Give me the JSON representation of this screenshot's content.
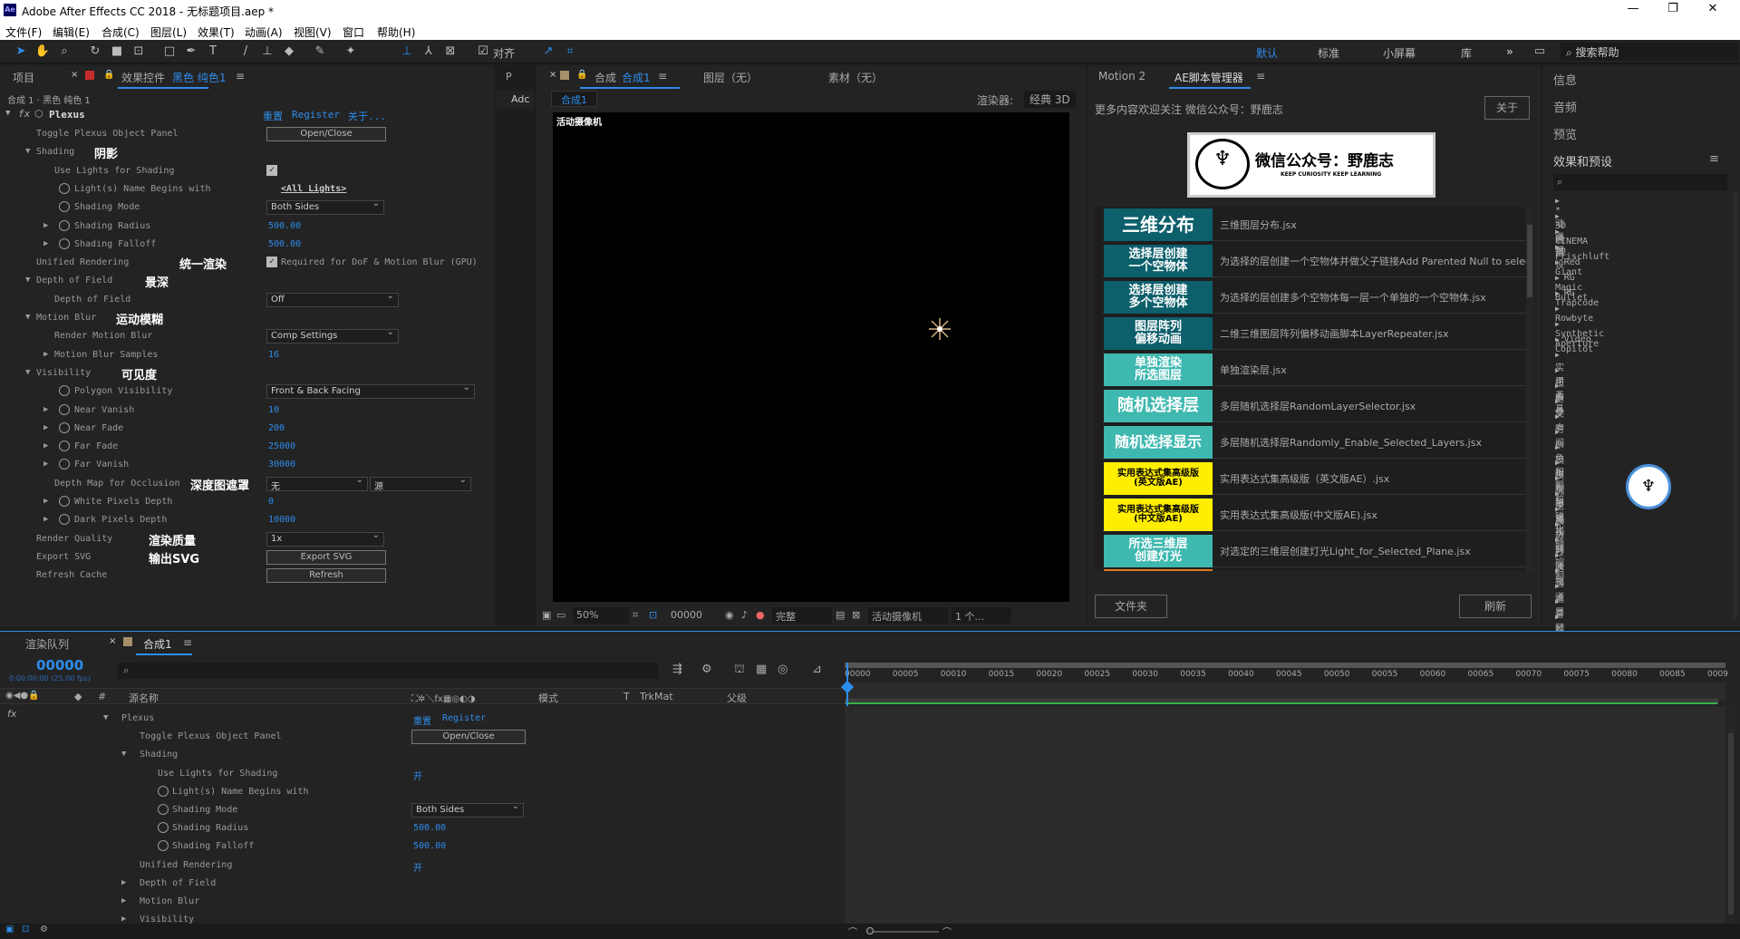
{
  "window": {
    "title": "Adobe After Effects CC 2018 - 无标题项目.aep *",
    "icon": "Ae",
    "min": "—",
    "max": "❐",
    "close": "✕"
  },
  "menu": [
    "文件(F)",
    "编辑(E)",
    "合成(C)",
    "图层(L)",
    "效果(T)",
    "动画(A)",
    "视图(V)",
    "窗口",
    "帮助(H)"
  ],
  "toolbar": {
    "align_label": "对齐",
    "workspaces": [
      "默认",
      "标准",
      "小屏幕",
      "库"
    ],
    "more": "»",
    "search_placeholder": "搜索帮助"
  },
  "project_panel": {
    "tab_project": "项目",
    "tab_effects_prefix": "效果控件",
    "tab_effects_layer": "黑色 纯色1",
    "menu": "≡",
    "breadcrumb": "合成 1 · 黑色 纯色 1",
    "effect_name": "Plexus",
    "reset": "重置",
    "register": "Register",
    "about": "关于..."
  },
  "effect_rows": [
    {
      "label": "Toggle Plexus Object Panel",
      "indent": 1,
      "button": "Open/Close"
    },
    {
      "label": "Shading",
      "indent": 1,
      "tri": "▼",
      "cn": "阴影"
    },
    {
      "label": "Use Lights for Shading",
      "indent": 3,
      "checkbox": true
    },
    {
      "label": "Light(s) Name Begins with",
      "indent": 3,
      "sw": true,
      "link": "<All Lights>"
    },
    {
      "label": "Shading Mode",
      "indent": 3,
      "sw": true,
      "dropdown": "Both Sides"
    },
    {
      "label": "Shading Radius",
      "indent": 3,
      "sw": true,
      "tri": "▶",
      "value": "500.00"
    },
    {
      "label": "Shading Falloff",
      "indent": 3,
      "sw": true,
      "tri": "▶",
      "value": "500.00"
    },
    {
      "label": "Unified Rendering",
      "indent": 1,
      "cn": "统一渲染",
      "checkbox": true,
      "checklabel": "Required for DoF & Motion Blur (GPU)"
    },
    {
      "label": "Depth of Field",
      "indent": 1,
      "tri": "▼",
      "cn": "景深"
    },
    {
      "label": "Depth of Field",
      "indent": 3,
      "dropdown": "Off"
    },
    {
      "label": "Motion Blur",
      "indent": 1,
      "tri": "▼",
      "cn": "运动模糊"
    },
    {
      "label": "Render Motion Blur",
      "indent": 3,
      "dropdown": "Comp Settings"
    },
    {
      "label": "Motion Blur Samples",
      "indent": 3,
      "tri": "▶",
      "value": "16"
    },
    {
      "label": "Visibility",
      "indent": 1,
      "tri": "▼",
      "cn": "可见度"
    },
    {
      "label": "Polygon Visibility",
      "indent": 3,
      "sw": true,
      "dropdown": "Front & Back Facing"
    },
    {
      "label": "Near Vanish",
      "indent": 3,
      "sw": true,
      "tri": "▶",
      "value": "10"
    },
    {
      "label": "Near Fade",
      "indent": 3,
      "sw": true,
      "tri": "▶",
      "value": "200"
    },
    {
      "label": "Far Fade",
      "indent": 3,
      "sw": true,
      "tri": "▶",
      "value": "25000"
    },
    {
      "label": "Far Vanish",
      "indent": 3,
      "sw": true,
      "tri": "▶",
      "value": "30000"
    },
    {
      "label": "Depth Map for Occlusion",
      "indent": 3,
      "cn": "深度图遮罩",
      "dropdown": "无",
      "dropdown2": "源"
    },
    {
      "label": "White Pixels Depth",
      "indent": 3,
      "sw": true,
      "tri": "▶",
      "value": "0"
    },
    {
      "label": "Dark Pixels Depth",
      "indent": 3,
      "sw": true,
      "tri": "▶",
      "value": "10000"
    },
    {
      "label": "Render Quality",
      "indent": 1,
      "cn": "渲染质量",
      "dropdown": "1x"
    },
    {
      "label": "Export SVG",
      "indent": 1,
      "cn": "输出SVG",
      "button": "Export SVG"
    },
    {
      "label": "Refresh Cache",
      "indent": 1,
      "button": "Refresh"
    }
  ],
  "small_panel": {
    "tab": "P",
    "tab2": "Adc"
  },
  "composition": {
    "tab_label": "合成",
    "tab_name": "合成1",
    "layer_tab": "图层（无）",
    "footage_tab": "素材（无）",
    "subtab": "合成1",
    "renderer_label": "渲染器:",
    "renderer": "经典 3D",
    "camera_label": "活动摄像机",
    "zoom": "50%",
    "timecode": "00000",
    "quality": "完整",
    "view": "活动摄像机",
    "views": "1 个..."
  },
  "script_panel": {
    "tab1": "Motion 2",
    "tab2": "AE脚本管理器",
    "notice": "更多内容欢迎关注 微信公众号：野鹿志",
    "about_btn": "关于",
    "banner_title": "微信公众号：野鹿志",
    "banner_sub": "KEEP CURIOSITY KEEP LEARNING",
    "logo_text": "野鹿志",
    "files_btn": "文件夹",
    "refresh_btn": "刷新",
    "items": [
      {
        "badge": "三维分布",
        "color": "#0c5f6b",
        "fg": "#ffffff",
        "size": 20,
        "desc": "三维图层分布.jsx"
      },
      {
        "badge": "选择层创建\n一个空物体",
        "color": "#0c5f6b",
        "fg": "#ffffff",
        "size": 13,
        "desc": "为选择的层创建一个空物体并做父子链接Add Parented Null to selected layers.jsx"
      },
      {
        "badge": "选择层创建\n多个空物体",
        "color": "#0c5f6b",
        "fg": "#ffffff",
        "size": 13,
        "desc": "为选择的层创建多个空物体每一层一个单独的一个空物体.jsx"
      },
      {
        "badge": "图层阵列\n偏移动画",
        "color": "#0c5f6b",
        "fg": "#ffffff",
        "size": 13,
        "desc": "二维三维图层阵列偏移动画脚本LayerRepeater.jsx"
      },
      {
        "badge": "单独渲染\n所选图层",
        "color": "#3fb8b0",
        "fg": "#ffffff",
        "size": 13,
        "desc": "单独渲染层.jsx"
      },
      {
        "badge": "随机选择层",
        "color": "#3fb8b0",
        "fg": "#ffffff",
        "size": 18,
        "desc": "多层随机选择层RandomLayerSelector.jsx"
      },
      {
        "badge": "随机选择显示",
        "color": "#3fb8b0",
        "fg": "#ffffff",
        "size": 16,
        "desc": "多层随机选择层Randomly_Enable_Selected_Layers.jsx"
      },
      {
        "badge": "实用表达式集高级版\n(英文版AE)",
        "color": "#ffee00",
        "fg": "#000000",
        "size": 10,
        "desc": "实用表达式集高级版（英文版AE）.jsx"
      },
      {
        "badge": "实用表达式集高级版\n(中文版AE)",
        "color": "#ffee00",
        "fg": "#000000",
        "size": 10,
        "desc": "实用表达式集高级版(中文版AE).jsx"
      },
      {
        "badge": "所选三维层\n创建灯光",
        "color": "#3fb8b0",
        "fg": "#ffffff",
        "size": 13,
        "desc": "对选定的三维层创建灯光Light_for_Selected_Plane.jsx"
      }
    ]
  },
  "right_panel": {
    "info": "信息",
    "audio": "音频",
    "preview": "预览",
    "effects_presets": "效果和预设",
    "search_placeholder": "",
    "list": [
      "* 动画预设",
      "3D 通道",
      "CINEMA 4D",
      "Frischluft",
      "Red Giant",
      "RG Magic Bullet",
      "RG Trapcode",
      "Rowbyte",
      "Synthetic Aperture",
      "Video Copilot",
      "实用工具",
      "扭曲",
      "抠像",
      "文本",
      "时间",
      "杂色和颗粒",
      "模拟",
      "模糊和锐化",
      "沉浸式视频",
      "生成",
      "表达式控制",
      "过时",
      "过渡",
      "透视",
      "通道",
      "遮罩",
      "音频",
      "颜色校正"
    ]
  },
  "timeline": {
    "tab_render": "渲染队列",
    "tab_comp": "合成1",
    "timecode": "00000",
    "timecode_sub": "0:00:00:00 (25.00 fps)",
    "search_placeholder": "",
    "col_source": "源名称",
    "col_mode": "模式",
    "col_t": "T",
    "col_trkmat": "TrkMat",
    "col_parent": "父级",
    "fx_label": "fx",
    "ruler": [
      "00000",
      "00005",
      "00010",
      "00015",
      "00020",
      "00025",
      "00030",
      "00035",
      "00040",
      "00045",
      "00050",
      "00055",
      "00060",
      "00065",
      "00070",
      "00075",
      "00080",
      "00085",
      "0009"
    ],
    "rows": [
      {
        "label": "Plexus",
        "indent": 0,
        "tri": "▼",
        "extra": "重置",
        "extra2": "Register"
      },
      {
        "label": "Toggle Plexus Object Panel",
        "indent": 1,
        "button": "Open/Close"
      },
      {
        "label": "Shading",
        "indent": 1,
        "tri": "▼"
      },
      {
        "label": "Use Lights for Shading",
        "indent": 2,
        "value": "开",
        "kf": true
      },
      {
        "label": "Light(s) Name Begins with",
        "indent": 2,
        "sw": true,
        "kf": true
      },
      {
        "label": "Shading Mode",
        "indent": 2,
        "sw": true,
        "dropdown": "Both Sides",
        "kf": true
      },
      {
        "label": "Shading Radius",
        "indent": 2,
        "sw": true,
        "value": "500.00",
        "kf": true
      },
      {
        "label": "Shading Falloff",
        "indent": 2,
        "sw": true,
        "value": "500.00",
        "kf": true
      },
      {
        "label": "Unified Rendering",
        "indent": 1,
        "value": "开",
        "kf": true
      },
      {
        "label": "Depth of Field",
        "indent": 1,
        "tri": "▶",
        "kf": true
      },
      {
        "label": "Motion Blur",
        "indent": 1,
        "tri": "▶",
        "kf": true
      },
      {
        "label": "Visibility",
        "indent": 1,
        "tri": "▶",
        "kf": true
      }
    ]
  }
}
